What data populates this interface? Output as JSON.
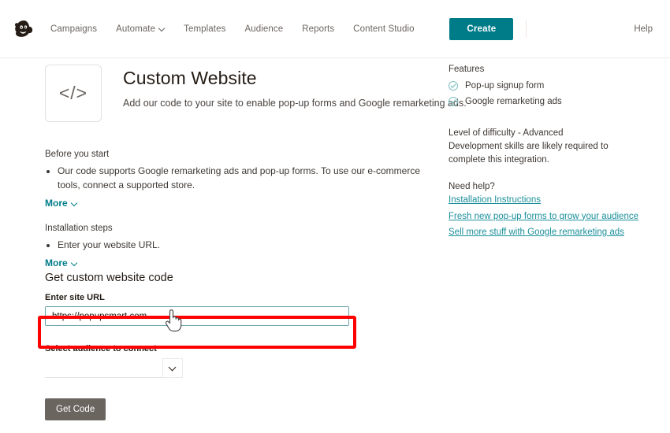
{
  "nav": {
    "logo_name": "mailchimp-logo",
    "items": [
      {
        "label": "Campaigns",
        "has_caret": false
      },
      {
        "label": "Automate",
        "has_caret": true
      },
      {
        "label": "Templates",
        "has_caret": false
      },
      {
        "label": "Audience",
        "has_caret": false
      },
      {
        "label": "Reports",
        "has_caret": false
      },
      {
        "label": "Content Studio",
        "has_caret": false
      }
    ],
    "create_label": "Create",
    "help_label": "Help",
    "accent_color": "#007c89"
  },
  "header": {
    "icon_glyph": "</>",
    "icon_name": "code-icon",
    "title": "Custom Website",
    "subtitle": "Add our code to your site to enable pop-up forms and Google remarketing ads."
  },
  "before_you_start": {
    "title": "Before you start",
    "bullets": [
      "Our code supports Google remarketing ads and pop-up forms. To use our e-commerce tools, connect a supported store."
    ],
    "more_label": "More"
  },
  "installation_steps": {
    "title": "Installation steps",
    "bullets": [
      "Enter your website URL."
    ],
    "more_label": "More"
  },
  "form": {
    "title": "Get custom website code",
    "url_label": "Enter site URL",
    "url_value": "https://popupsmart.com",
    "url_placeholder": "",
    "audience_label": "Select audience to connect",
    "audience_selected": "",
    "submit_label": "Get Code",
    "highlight_color": "#fe0000",
    "input_border_color": "#6ea5ad",
    "submit_color": "#6b6560"
  },
  "sidebar": {
    "features_title": "Features",
    "features": [
      "Pop-up signup form",
      "Google remarketing ads"
    ],
    "difficulty_title": "Level of difficulty - Advanced",
    "difficulty_body": "Development skills are likely required to complete this integration.",
    "help_title": "Need help?",
    "links": [
      "Installation Instructions",
      "Fresh new pop-up forms to grow your audience",
      "Sell more stuff with Google remarketing ads"
    ],
    "link_color": "#1b8f9b",
    "check_color": "#7fbfc2"
  }
}
